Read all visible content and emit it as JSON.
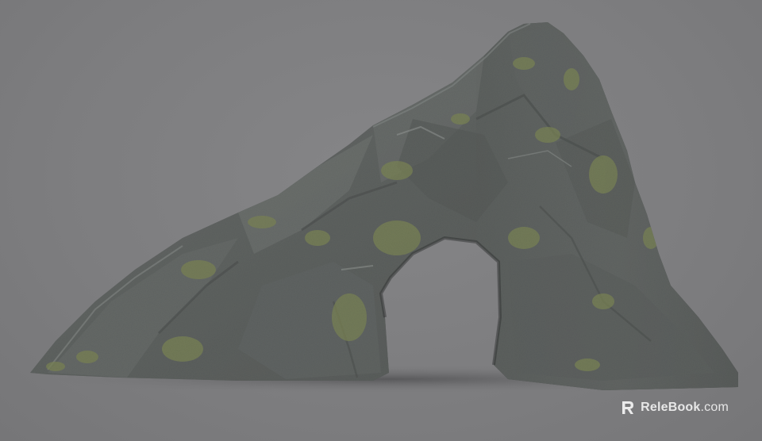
{
  "image": {
    "subject": "rock-arch",
    "colors": {
      "background": "#7e7e80",
      "ground": "#79797b",
      "rock_dark": "#3a3d3c",
      "rock_mid": "#5b5f5e",
      "rock_light": "#8a8f8d",
      "moss": "#8a9a3a",
      "shadow": "#5e5e60"
    }
  },
  "watermark": {
    "brand": "ReleBook",
    "tld": ".com",
    "icon": "relebook-logo-icon"
  }
}
